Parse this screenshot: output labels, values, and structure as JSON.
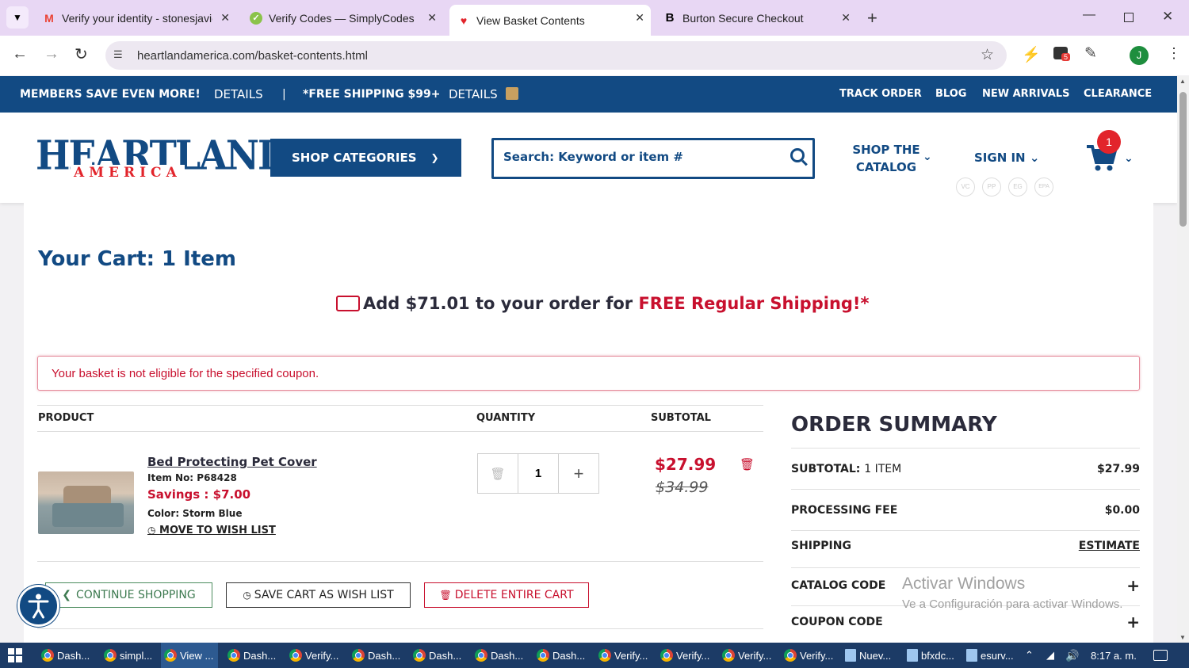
{
  "browser": {
    "tabs": [
      {
        "title": "Verify your identity - stonesjavie",
        "icon": "gmail-icon"
      },
      {
        "title": "Verify Codes — SimplyCodes",
        "icon": "simplycodes-icon"
      },
      {
        "title": "View Basket Contents",
        "icon": "heartland-icon",
        "active": true
      },
      {
        "title": "Burton Secure Checkout",
        "icon": "burton-icon"
      }
    ],
    "url": "heartlandamerica.com/basket-contents.html",
    "ext_badge": "5",
    "profile_initial": "J"
  },
  "promo_bar": {
    "members": "MEMBERS SAVE EVEN MORE!",
    "details1": "DETAILS",
    "sep": "|",
    "free_ship": "*FREE SHIPPING $99+",
    "details2": "DETAILS",
    "links": [
      "TRACK ORDER",
      "BLOG",
      "NEW ARRIVALS",
      "CLEARANCE"
    ]
  },
  "header": {
    "logo_main": "HEARTLAND",
    "logo_sub": "AMERICA",
    "shop_categories": "SHOP CATEGORIES",
    "search_placeholder": "Search: Keyword or item #",
    "shop_catalog_line1": "SHOP THE",
    "shop_catalog_line2": "CATALOG",
    "sign_in": "SIGN IN",
    "cart_count": "1",
    "payment_badges": [
      "VC",
      "PP",
      "EG",
      "EPA"
    ]
  },
  "cart": {
    "title": "Your Cart: 1 Item",
    "shipping_msg_prefix": "Add $71.01 to your order for ",
    "shipping_msg_highlight": "FREE Regular Shipping!*",
    "alert": "Your basket is not eligible for the specified coupon.",
    "columns": {
      "product": "PRODUCT",
      "quantity": "QUANTITY",
      "subtotal": "SUBTOTAL"
    },
    "item": {
      "name": "Bed Protecting Pet Cover",
      "item_no": "Item No: P68428",
      "savings": "Savings : $7.00",
      "color": "Color: Storm Blue",
      "wish": "MOVE TO WISH LIST",
      "qty": "1",
      "price": "$27.99",
      "orig_price": "$34.99"
    },
    "buttons": {
      "continue": "CONTINUE SHOPPING",
      "save_wish": "SAVE CART AS WISH LIST",
      "delete_all": "DELETE ENTIRE CART"
    }
  },
  "summary": {
    "title": "ORDER SUMMARY",
    "subtotal_label": "SUBTOTAL:",
    "subtotal_items": "1 ITEM",
    "subtotal_value": "$27.99",
    "fee_label": "PROCESSING FEE",
    "fee_value": "$0.00",
    "shipping_label": "SHIPPING",
    "shipping_value": "ESTIMATE",
    "catalog_label": "CATALOG CODE",
    "coupon_label": "COUPON CODE",
    "plus": "+"
  },
  "watermark": {
    "line1": "Activar Windows",
    "line2": "Ve a Configuración para activar Windows."
  },
  "taskbar": {
    "items": [
      "Dash...",
      "simpl...",
      "View ...",
      "Dash...",
      "Verify...",
      "Dash...",
      "Dash...",
      "Dash...",
      "Dash...",
      "Verify...",
      "Verify...",
      "Verify...",
      "Verify...",
      "Nuev...",
      "bfxdc...",
      "esurv..."
    ],
    "time": "8:17 a. m."
  },
  "colors": {
    "brand_blue": "#124a83",
    "brand_red": "#c8102e",
    "tab_bar": "#e8d7f4"
  }
}
